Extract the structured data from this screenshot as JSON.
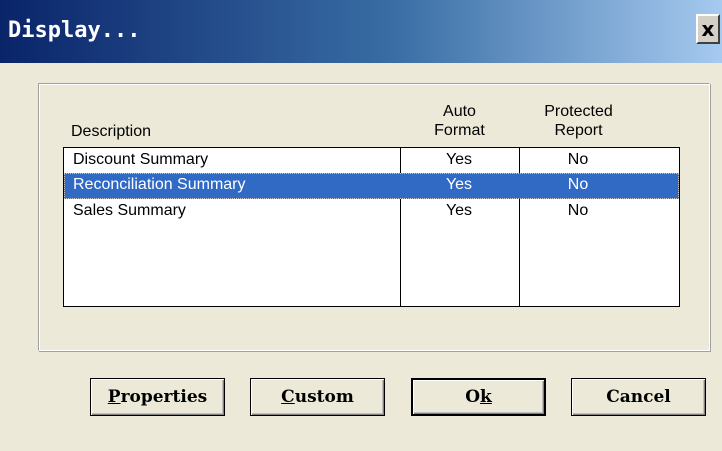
{
  "window": {
    "title": "Display...",
    "close_label": "x"
  },
  "table": {
    "headers": {
      "description": "Description",
      "auto_format_line1": "Auto",
      "auto_format_line2": "Format",
      "protected_line1": "Protected",
      "protected_line2": "Report"
    },
    "rows": [
      {
        "description": "Discount Summary",
        "auto_format": "Yes",
        "protected": "No",
        "selected": false
      },
      {
        "description": "Reconciliation Summary",
        "auto_format": "Yes",
        "protected": "No",
        "selected": true
      },
      {
        "description": "Sales Summary",
        "auto_format": "Yes",
        "protected": "No",
        "selected": false
      }
    ]
  },
  "buttons": {
    "properties": {
      "accel": "P",
      "rest": "roperties"
    },
    "custom": {
      "accel": "C",
      "rest": "ustom"
    },
    "ok": {
      "pre": "O",
      "accel": "k"
    },
    "cancel": {
      "label": "Cancel"
    }
  },
  "colors": {
    "selection": "#316ac5",
    "titlebar_start": "#0a246a",
    "dialog_bg": "#ece9d8"
  }
}
